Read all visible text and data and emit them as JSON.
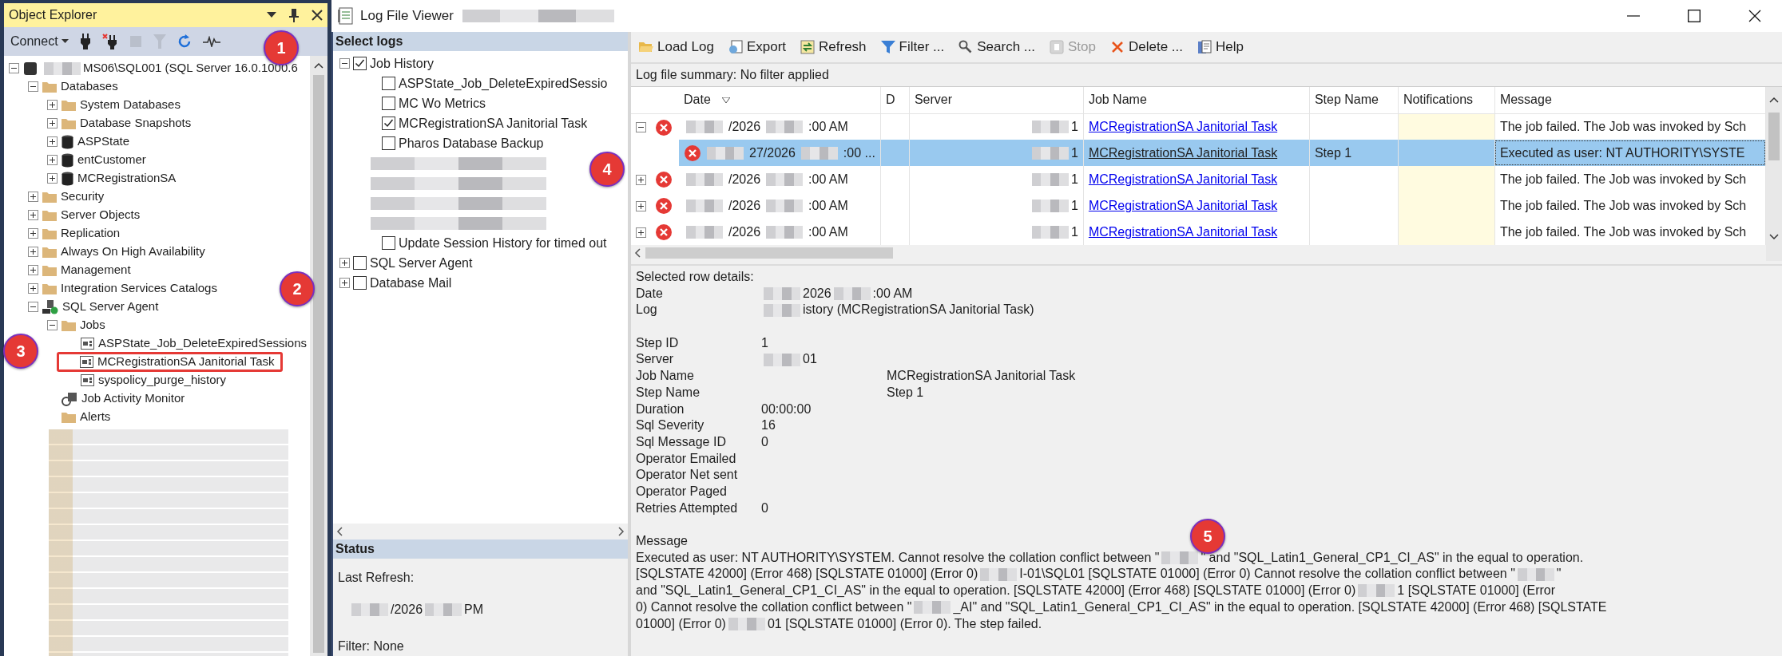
{
  "object_explorer": {
    "title": "Object Explorer",
    "connect": "Connect",
    "tree": [
      {
        "kind": "server",
        "label": [
          {
            "kind": "redacted"
          },
          {
            "text": "MS06\\SQL001 (SQL Server 16.0.1000.6"
          }
        ],
        "expanded": true,
        "children": [
          {
            "kind": "folder",
            "label": [
              {
                "text": "Databases"
              }
            ],
            "expanded": true,
            "children": [
              {
                "kind": "folder",
                "label": [
                  {
                    "text": "System Databases"
                  }
                ],
                "expanded": false
              },
              {
                "kind": "folder",
                "label": [
                  {
                    "text": "Database Snapshots"
                  }
                ],
                "expanded": false
              },
              {
                "kind": "database",
                "label": [
                  {
                    "text": "ASPState"
                  }
                ],
                "expanded": false
              },
              {
                "kind": "database",
                "label": [
                  {
                    "text": "entCustomer"
                  }
                ],
                "expanded": false
              },
              {
                "kind": "database",
                "label": [
                  {
                    "text": "MCRegistrationSA"
                  }
                ],
                "expanded": false
              }
            ]
          },
          {
            "kind": "folder",
            "label": [
              {
                "text": "Security"
              }
            ],
            "expanded": false
          },
          {
            "kind": "folder",
            "label": [
              {
                "text": "Server Objects"
              }
            ],
            "expanded": false
          },
          {
            "kind": "folder",
            "label": [
              {
                "text": "Replication"
              }
            ],
            "expanded": false
          },
          {
            "kind": "folder",
            "label": [
              {
                "text": "Always On High Availability"
              }
            ],
            "expanded": false
          },
          {
            "kind": "folder",
            "label": [
              {
                "text": "Management"
              }
            ],
            "expanded": false
          },
          {
            "kind": "folder",
            "label": [
              {
                "text": "Integration Services Catalogs"
              }
            ],
            "expanded": false
          },
          {
            "kind": "agent",
            "label": [
              {
                "text": "SQL Server Agent"
              }
            ],
            "expanded": true,
            "children": [
              {
                "kind": "folder",
                "label": [
                  {
                    "text": "Jobs"
                  }
                ],
                "expanded": true,
                "children": [
                  {
                    "kind": "job",
                    "label": [
                      {
                        "text": "ASPState_Job_DeleteExpiredSessions"
                      }
                    ],
                    "outlined": false
                  },
                  {
                    "kind": "job",
                    "label": [
                      {
                        "text": "MCRegistrationSA Janitorial Task"
                      }
                    ],
                    "outlined": true
                  },
                  {
                    "kind": "job",
                    "label": [
                      {
                        "text": "syspolicy_purge_history"
                      }
                    ],
                    "outlined": false
                  }
                ]
              },
              {
                "kind": "monitor",
                "label": [
                  {
                    "text": "Job Activity Monitor"
                  }
                ]
              },
              {
                "kind": "folder",
                "label": [
                  {
                    "text": "Alerts"
                  }
                ]
              }
            ]
          }
        ]
      }
    ]
  },
  "log_viewer": {
    "title": "Log File Viewer",
    "select_logs": {
      "title": "Select logs",
      "tree": [
        {
          "label": "Job History",
          "checked": true,
          "expanded": true,
          "children": [
            {
              "label": "ASPState_Job_DeleteExpiredSessio",
              "checked": false
            },
            {
              "label": "MC Wo Metrics",
              "checked": false
            },
            {
              "label": "MCRegistrationSA Janitorial Task",
              "checked": true
            },
            {
              "label": "Pharos Database Backup",
              "checked": false
            },
            {
              "kind": "redacted"
            },
            {
              "kind": "redacted"
            },
            {
              "kind": "redacted"
            },
            {
              "kind": "redacted"
            },
            {
              "label": "Update Session History for timed out",
              "checked": false
            }
          ]
        },
        {
          "label": "SQL Server Agent",
          "checked": false,
          "expanded": false
        },
        {
          "label": "Database Mail",
          "checked": false,
          "expanded": false
        }
      ]
    },
    "status": {
      "title": "Status",
      "last_refresh_label": "Last Refresh:",
      "last_refresh": [
        {
          "kind": "redacted"
        },
        {
          "text": "/2026"
        },
        {
          "kind": "redacted"
        },
        {
          "text": "PM"
        }
      ],
      "filter": "Filter: None"
    },
    "toolbar": [
      {
        "kind": "load",
        "label": "Load Log",
        "disabled": false
      },
      {
        "kind": "export",
        "label": "Export",
        "disabled": false
      },
      {
        "kind": "refresh",
        "label": "Refresh",
        "disabled": false
      },
      {
        "kind": "filter",
        "label": "Filter ...",
        "disabled": false
      },
      {
        "kind": "search",
        "label": "Search ...",
        "disabled": false
      },
      {
        "kind": "stop",
        "label": "Stop",
        "disabled": true
      },
      {
        "kind": "delete",
        "label": "Delete ...",
        "disabled": false
      },
      {
        "kind": "help",
        "label": "Help",
        "disabled": false
      }
    ],
    "summary": "Log file summary: No filter applied",
    "columns": [
      "Date",
      "D",
      "Server",
      "Job Name",
      "Step Name",
      "Notifications",
      "Message"
    ],
    "rows": [
      {
        "expanded": true,
        "child": false,
        "selected": false,
        "date": [
          {
            "kind": "redacted"
          },
          {
            "text": "/2026"
          },
          {
            "kind": "redacted"
          },
          {
            "text": ":00 AM"
          }
        ],
        "server": [
          {
            "kind": "redacted"
          },
          {
            "text": "1"
          }
        ],
        "job": "MCRegistrationSA Janitorial Task",
        "step": "",
        "message": "The job failed.  The Job was invoked by Sch"
      },
      {
        "child": true,
        "selected": true,
        "date": [
          {
            "kind": "redacted"
          },
          {
            "text": "27/2026"
          },
          {
            "kind": "redacted"
          },
          {
            "text": ":00 ..."
          }
        ],
        "server": [
          {
            "kind": "redacted"
          },
          {
            "text": "1"
          }
        ],
        "job": "MCRegistrationSA Janitorial Task",
        "step": "Step 1",
        "message": "Executed as user: NT AUTHORITY\\SYSTE"
      },
      {
        "expanded": false,
        "child": false,
        "selected": false,
        "date": [
          {
            "kind": "redacted"
          },
          {
            "text": "/2026"
          },
          {
            "kind": "redacted"
          },
          {
            "text": ":00 AM"
          }
        ],
        "server": [
          {
            "kind": "redacted"
          },
          {
            "text": "1"
          }
        ],
        "job": "MCRegistrationSA Janitorial Task",
        "step": "",
        "message": "The job failed.  The Job was invoked by Sch"
      },
      {
        "expanded": false,
        "child": false,
        "selected": false,
        "date": [
          {
            "kind": "redacted"
          },
          {
            "text": "/2026"
          },
          {
            "kind": "redacted"
          },
          {
            "text": ":00 AM"
          }
        ],
        "server": [
          {
            "kind": "redacted"
          },
          {
            "text": "1"
          }
        ],
        "job": "MCRegistrationSA Janitorial Task",
        "step": "",
        "message": "The job failed.  The Job was invoked by Sch"
      },
      {
        "expanded": false,
        "child": false,
        "selected": false,
        "date": [
          {
            "kind": "redacted"
          },
          {
            "text": "/2026"
          },
          {
            "kind": "redacted"
          },
          {
            "text": ":00 AM"
          }
        ],
        "server": [
          {
            "kind": "redacted"
          },
          {
            "text": "1"
          }
        ],
        "job": "MCRegistrationSA Janitorial Task",
        "step": "",
        "message": "The job failed.  The Job was invoked by Sch"
      }
    ],
    "details": {
      "title": "Selected row details:",
      "fields": [
        {
          "label": "Date",
          "value": [
            {
              "kind": "redacted"
            },
            {
              "text": "2026"
            },
            {
              "kind": "redacted"
            },
            {
              "text": ":00 AM"
            }
          ],
          "indent": false
        },
        {
          "label": "Log",
          "value": [
            {
              "kind": "redacted"
            },
            {
              "text": "istory (MCRegistrationSA Janitorial Task)"
            }
          ],
          "indent": false
        },
        {
          "kind": "blank"
        },
        {
          "label": "Step ID",
          "value": [
            {
              "text": "1"
            }
          ],
          "indent": false
        },
        {
          "label": "Server",
          "value": [
            {
              "kind": "redacted"
            },
            {
              "text": "01"
            }
          ],
          "indent": false
        },
        {
          "label": "Job Name",
          "value": [
            {
              "text": "MCRegistrationSA Janitorial Task"
            }
          ],
          "indent": true
        },
        {
          "label": "Step Name",
          "value": [
            {
              "text": "Step 1"
            }
          ],
          "indent": true
        },
        {
          "label": "Duration",
          "value": [
            {
              "text": "00:00:00"
            }
          ],
          "indent": false
        },
        {
          "label": "Sql Severity",
          "value": [
            {
              "text": "16"
            }
          ],
          "indent": false
        },
        {
          "label": "Sql Message ID",
          "value": [
            {
              "text": "0"
            }
          ],
          "indent": false
        },
        {
          "label": "Operator Emailed"
        },
        {
          "label": "Operator Net sent"
        },
        {
          "label": "Operator Paged"
        },
        {
          "label": "Retries Attempted",
          "value": [
            {
              "text": "0"
            }
          ],
          "indent": false
        }
      ],
      "message_label": "Message",
      "message_lines": [
        [
          {
            "text": "Executed as user: NT AUTHORITY\\SYSTEM. Cannot resolve the collation conflict between \""
          },
          {
            "kind": "redacted"
          },
          {
            "text": "\" and \"SQL_Latin1_General_CP1_CI_AS\" in the equal to operation."
          }
        ],
        [
          {
            "text": "[SQLSTATE 42000] (Error 468)   [SQLSTATE 01000] (Error 0)"
          },
          {
            "kind": "redacted"
          },
          {
            "text": "I-01\\SQL01 [SQLSTATE 01000] (Error 0)  Cannot resolve the collation conflict between \""
          },
          {
            "kind": "redacted"
          },
          {
            "text": "\""
          }
        ],
        [
          {
            "text": "and \"SQL_Latin1_General_CP1_CI_AS\" in the equal to operation. [SQLSTATE 42000] (Error 468)   [SQLSTATE 01000] (Error 0)"
          },
          {
            "kind": "redacted"
          },
          {
            "text": "1 [SQLSTATE 01000] (Error"
          }
        ],
        [
          {
            "text": "0)  Cannot resolve the collation conflict between \""
          },
          {
            "kind": "redacted"
          },
          {
            "text": "_AI\" and \"SQL_Latin1_General_CP1_CI_AS\" in the equal to operation. [SQLSTATE 42000] (Error 468)   [SQLSTATE"
          }
        ],
        [
          {
            "text": "01000] (Error 0)"
          },
          {
            "kind": "redacted"
          },
          {
            "text": "01 [SQLSTATE 01000] (Error 0).  The step failed."
          }
        ]
      ]
    }
  },
  "callouts": [
    "1",
    "2",
    "3",
    "4",
    "5"
  ]
}
